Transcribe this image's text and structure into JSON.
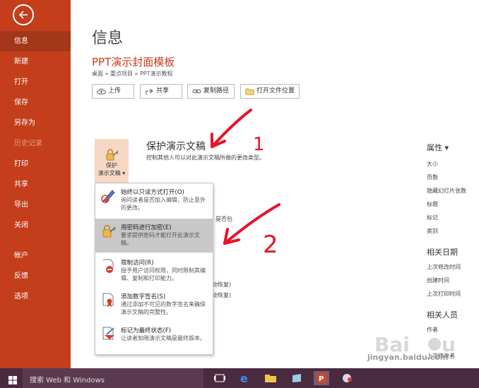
{
  "sidebar": {
    "items": [
      {
        "label": "信息"
      },
      {
        "label": "新建"
      },
      {
        "label": "打开"
      },
      {
        "label": "保存"
      },
      {
        "label": "另存为"
      },
      {
        "label": "历史记录"
      },
      {
        "label": "打印"
      },
      {
        "label": "共享"
      },
      {
        "label": "导出"
      },
      {
        "label": "关闭"
      },
      {
        "label": "帐户"
      },
      {
        "label": "反馈"
      },
      {
        "label": "选项"
      }
    ]
  },
  "main": {
    "page_title": "信息",
    "doc_title": "PPT演示封面模板",
    "breadcrumb": "桌面 » 重点项目 » PPT演示教程",
    "actions": {
      "upload": "上传",
      "share": "共享",
      "copy_path": "复制路径",
      "open_location": "打开文件位置"
    },
    "protect": {
      "tile_label_1": "保护",
      "tile_label_2": "演示文稿",
      "heading": "保护演示文稿",
      "desc": "控制其他人可以对此演示文稿所做的更改类型。"
    },
    "partial": {
      "p1": "是否包",
      "p2": "动恢复)",
      "p3": "动恢复)"
    }
  },
  "menu": {
    "items": [
      {
        "title": "始终以只读方式打开(O)",
        "desc": "询问读者是否加入编辑，防止意外的更改。"
      },
      {
        "title": "用密码进行加密(E)",
        "desc": "要求提供密码才能打开此演示文稿。"
      },
      {
        "title": "限制访问(R)",
        "desc": "授予用户访问权限，同时限制其编辑、复制和打印能力。"
      },
      {
        "title": "添加数字签名(S)",
        "desc": "通过添加不可见的数字签名来确保演示文稿的完整性。"
      },
      {
        "title": "标记为最终状态(F)",
        "desc": "让读者知晓演示文稿是最终版本。"
      }
    ]
  },
  "properties": {
    "heading": "属性",
    "items": [
      "大小",
      "页数",
      "隐藏幻灯片张数",
      "标题",
      "标记",
      "类别"
    ],
    "dates_heading": "相关日期",
    "dates": [
      "上次修改时间",
      "创建时间",
      "上次打印时间"
    ],
    "people_heading": "相关人员",
    "people": [
      "作者",
      "上次修改者"
    ]
  },
  "annotations": {
    "n1": "1",
    "n2": "2"
  },
  "taskbar": {
    "search": "搜索 Web 和 Windows"
  },
  "watermark": {
    "text": "jingyan.baidu.com"
  },
  "colors": {
    "sidebar": "#c43e1c",
    "sidebar_active": "#a4361a",
    "accent_title": "#c43e1c",
    "menu_highlight": "#c8c8c8",
    "annotation_ink": "#e8142a",
    "taskbar": "#4a2a3f"
  }
}
